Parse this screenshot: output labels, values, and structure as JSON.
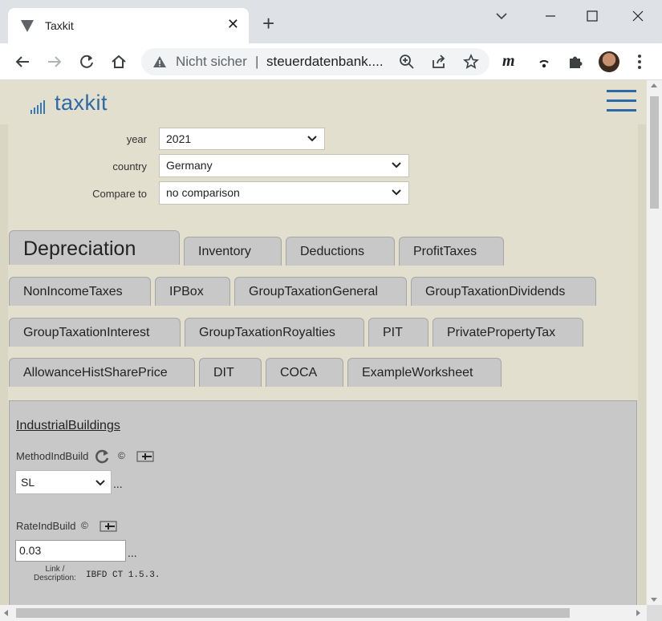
{
  "browser": {
    "tab_title": "Taxkit",
    "address_status": "Nicht sicher",
    "address_separator": "|",
    "address_url": "steuerdatenbank...."
  },
  "app": {
    "logo_text": "taxkit"
  },
  "filters": {
    "year_label": "year",
    "year_value": "2021",
    "country_label": "country",
    "country_value": "Germany",
    "compare_label": "Compare to",
    "compare_value": "no comparison"
  },
  "tabs": [
    "Depreciation",
    "Inventory",
    "Deductions",
    "ProfitTaxes",
    "NonIncomeTaxes",
    "IPBox",
    "GroupTaxationGeneral",
    "GroupTaxationDividends",
    "GroupTaxationInterest",
    "GroupTaxationRoyalties",
    "PIT",
    "PrivatePropertyTax",
    "AllowanceHistSharePrice",
    "DIT",
    "COCA",
    "ExampleWorksheet"
  ],
  "panel": {
    "section_title": "IndustrialBuildings",
    "method_label": "MethodIndBuild",
    "method_value": "SL",
    "rate_label": "RateIndBuild",
    "rate_value": "0.03",
    "ellipsis": "...",
    "copyright_symbol": "©",
    "link_label_1": "Link /",
    "link_label_2": "Description:",
    "link_value": "IBFD CT 1.5.3."
  },
  "colors": {
    "page_bg": "#e3dfcf",
    "brand_blue": "#2b6aa6",
    "tab_bg": "#c8c8c8"
  }
}
